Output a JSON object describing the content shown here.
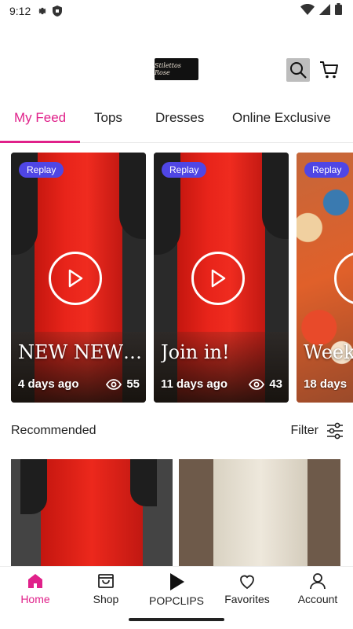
{
  "status_bar": {
    "time": "9:12",
    "icons": [
      "settings-gear-icon",
      "shield-icon",
      "wifi-icon",
      "signal-icon",
      "battery-icon"
    ]
  },
  "header": {
    "logo_text": "Stilettos Rose",
    "search_icon": "search-icon",
    "cart_icon": "cart-icon"
  },
  "tabs": [
    {
      "label": "My Feed",
      "active": true
    },
    {
      "label": "Tops",
      "active": false
    },
    {
      "label": "Dresses",
      "active": false
    },
    {
      "label": "Online Exclusive",
      "active": false
    }
  ],
  "clips": [
    {
      "badge": "Replay",
      "title": "NEW NEW N...",
      "age": "4 days ago",
      "views": "55"
    },
    {
      "badge": "Replay",
      "title": "Join in!",
      "age": "11 days ago",
      "views": "43"
    },
    {
      "badge": "Replay",
      "title": "Weekl",
      "age": "18 days",
      "views": ""
    }
  ],
  "recommended": {
    "title": "Recommended",
    "filter_label": "Filter"
  },
  "bottom_nav": [
    {
      "label": "Home",
      "icon": "home-icon",
      "active": true
    },
    {
      "label": "Shop",
      "icon": "shopping-bag-icon",
      "active": false
    },
    {
      "label": "POPCLIPS",
      "icon": "play-icon",
      "active": false
    },
    {
      "label": "Favorites",
      "icon": "heart-icon",
      "active": false
    },
    {
      "label": "Account",
      "icon": "user-icon",
      "active": false
    }
  ],
  "colors": {
    "accent": "#e0218a",
    "badge": "#4f46e5"
  }
}
